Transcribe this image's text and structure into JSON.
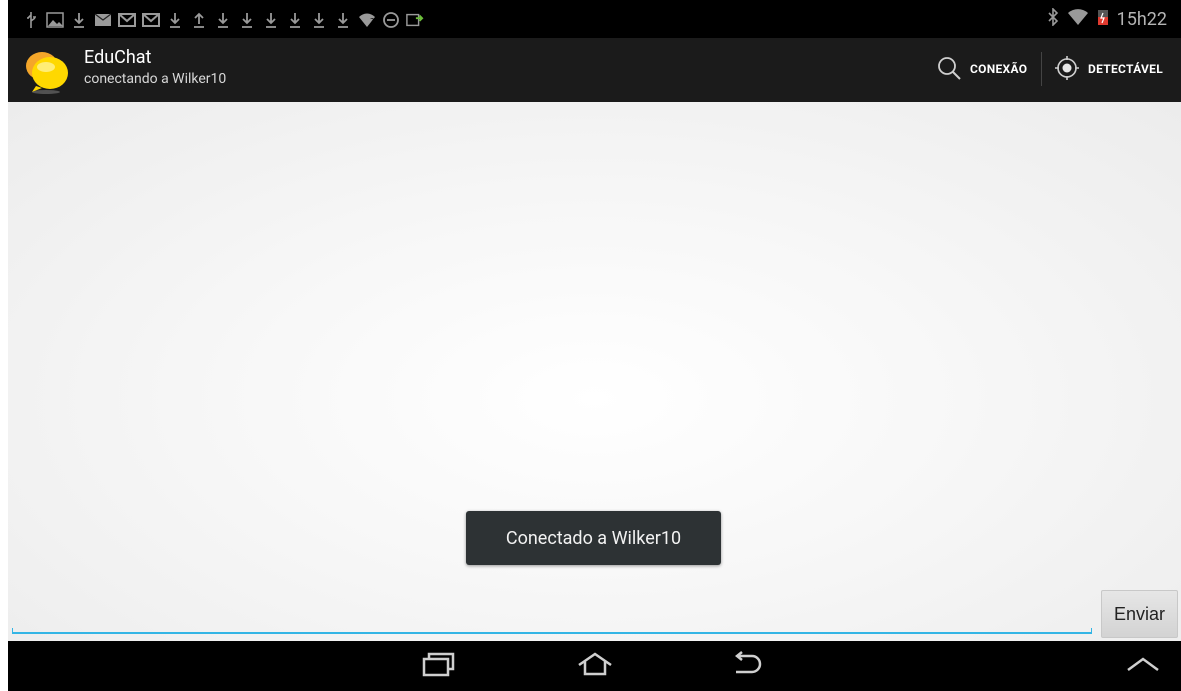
{
  "status_bar": {
    "clock": "15h22",
    "left_icons": [
      "usb-icon",
      "image-icon",
      "download-icon",
      "mail-icon",
      "gmail-icon",
      "gmail-icon",
      "download-icon",
      "upload-icon",
      "download-icon",
      "download-icon",
      "download-icon",
      "download-icon",
      "download-icon",
      "download-icon",
      "wifi-icon",
      "block-icon",
      "battery-charge-icon"
    ],
    "right_icons": [
      "bluetooth-icon",
      "wifi-signal-icon",
      "battery-icon"
    ]
  },
  "action_bar": {
    "title": "EduChat",
    "subtitle": "conectando a Wilker10",
    "connect_label": "CONEXÃO",
    "discoverable_label": "DETECTÁVEL"
  },
  "toast": {
    "text": "Conectado a Wilker10"
  },
  "composer": {
    "input_value": "",
    "send_label": "Enviar"
  },
  "colors": {
    "accent": "#33b5e5",
    "actionbar": "#1b1b1b",
    "toast_bg": "#2d3234"
  }
}
